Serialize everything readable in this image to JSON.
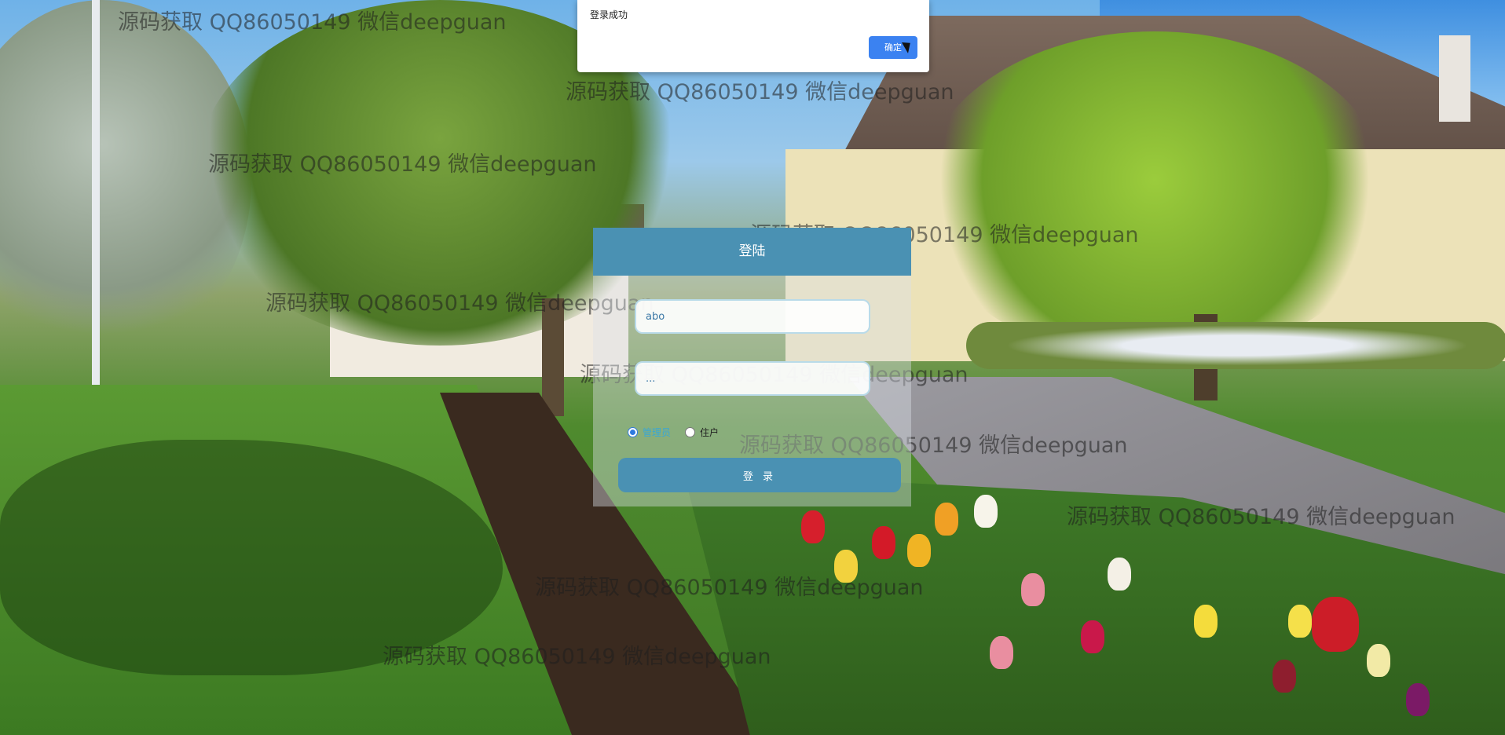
{
  "alert": {
    "message": "登录成功",
    "ok_label": "确定"
  },
  "login": {
    "title": "登陆",
    "username_value": "abo",
    "password_value": "...",
    "roles": [
      {
        "label": "管理员",
        "selected": true
      },
      {
        "label": "住户",
        "selected": false
      }
    ],
    "submit_label": "登 录"
  },
  "watermark": {
    "text": "源码获取 QQ86050149 微信deepguan"
  },
  "colors": {
    "header": "#4a91b3",
    "button": "#4a91b3",
    "alert_ok": "#3b82f1"
  }
}
